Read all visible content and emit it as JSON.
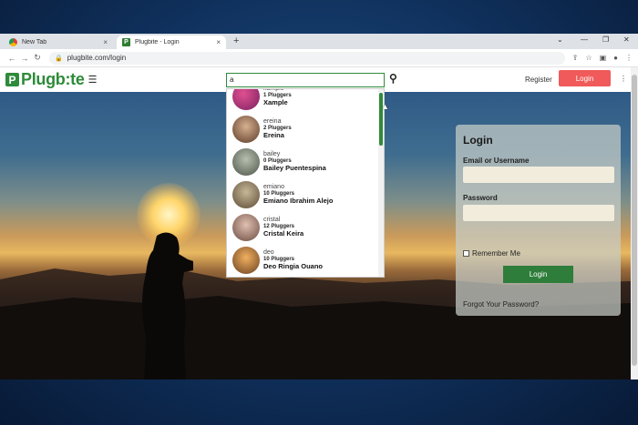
{
  "browser": {
    "tabs": [
      {
        "title": "New Tab",
        "close": "×"
      },
      {
        "title": "Plugbite - Login",
        "close": "×"
      }
    ],
    "new_tab": "+",
    "url": "plugbite.com/login",
    "window_controls": [
      "⌄",
      "—",
      "❐",
      "✕"
    ]
  },
  "site": {
    "logo_mark": "P",
    "logo_text": "Plugb:te",
    "search_value": "a",
    "register_label": "Register",
    "login_label": "Login"
  },
  "dropdown": {
    "items": [
      {
        "username": "xample",
        "pluggers": "1 Pluggers",
        "name": "Xample",
        "avatar_color": "#b03070"
      },
      {
        "username": "ereina",
        "pluggers": "2 Pluggers",
        "name": "Ereina",
        "avatar_color": "#7a5a40"
      },
      {
        "username": "bailey",
        "pluggers": "0 Pluggers",
        "name": "Bailey Puentespina",
        "avatar_color": "#6a7a70"
      },
      {
        "username": "emiano",
        "pluggers": "10 Pluggers",
        "name": "Emiano Ibrahim Alejo",
        "avatar_color": "#8a7a60"
      },
      {
        "username": "cristal",
        "pluggers": "12 Pluggers",
        "name": "Cristal Keira",
        "avatar_color": "#9a7a6a"
      },
      {
        "username": "deo",
        "pluggers": "10 Pluggers",
        "name": "Deo Ringia Ouano",
        "avatar_color": "#c08a50"
      }
    ]
  },
  "login_panel": {
    "title": "Login",
    "email_label": "Email or Username",
    "password_label": "Password",
    "remember_label": "Remember Me",
    "submit_label": "Login",
    "forgot_label": "Forgot Your Password?"
  }
}
